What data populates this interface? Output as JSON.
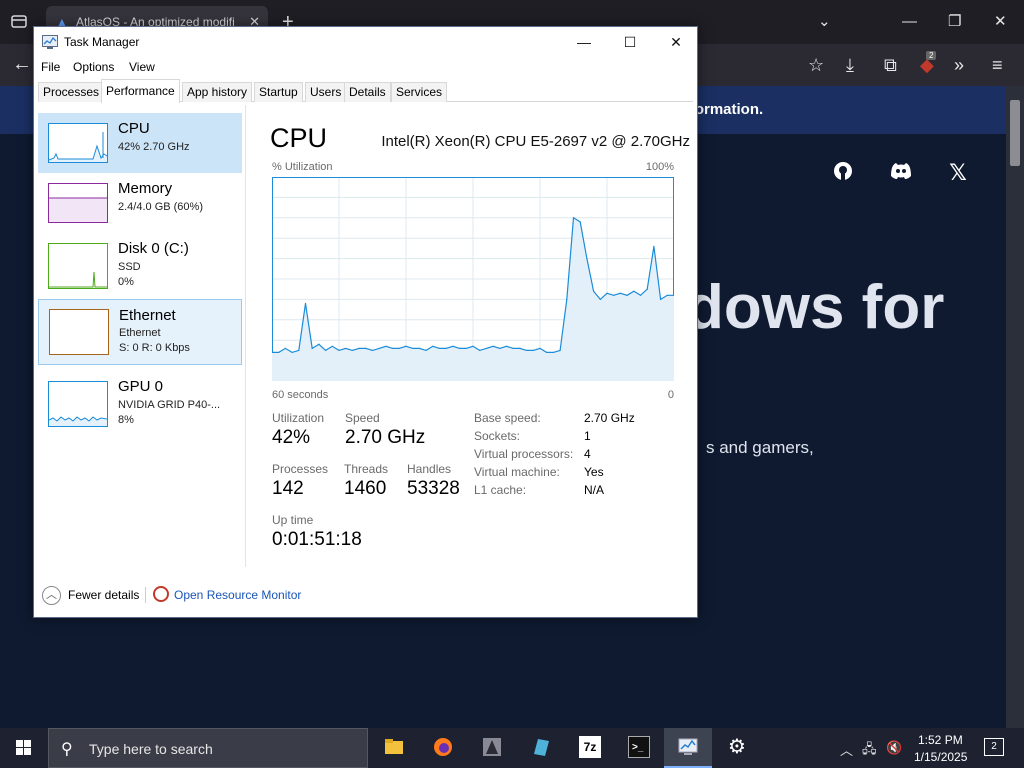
{
  "browser": {
    "tab_title": "AtlasOS - An optimized modifi",
    "new_tab": "+",
    "banner_text": "e information.",
    "hero_text": "dows for",
    "sub_text": "s and gamers,",
    "ublock_count": "2"
  },
  "task_manager": {
    "title": "Task Manager",
    "menu": [
      "File",
      "Options",
      "View"
    ],
    "tabs": [
      "Processes",
      "Performance",
      "App history",
      "Startup",
      "Users",
      "Details",
      "Services"
    ],
    "active_tab": "Performance",
    "resources": [
      {
        "name": "CPU",
        "lines": [
          "42%  2.70 GHz"
        ],
        "color": "#1a8cd8"
      },
      {
        "name": "Memory",
        "lines": [
          "2.4/4.0 GB (60%)"
        ],
        "color": "#8b2a9e"
      },
      {
        "name": "Disk 0 (C:)",
        "lines": [
          "SSD",
          "0%"
        ],
        "color": "#4da81e"
      },
      {
        "name": "Ethernet",
        "lines": [
          "Ethernet",
          "S: 0  R: 0 Kbps"
        ],
        "color": "#a9641c"
      },
      {
        "name": "GPU 0",
        "lines": [
          "NVIDIA GRID P40-...",
          "8%"
        ],
        "color": "#1a8cd8"
      }
    ],
    "cpu": {
      "heading": "CPU",
      "model": "Intel(R) Xeon(R) CPU E5-2697 v2 @ 2.70GHz",
      "chart_top_left": "% Utilization",
      "chart_top_right": "100%",
      "chart_bottom_left": "60 seconds",
      "chart_bottom_right": "0",
      "stats": {
        "utilization_label": "Utilization",
        "utilization": "42%",
        "speed_label": "Speed",
        "speed": "2.70 GHz",
        "processes_label": "Processes",
        "processes": "142",
        "threads_label": "Threads",
        "threads": "1460",
        "handles_label": "Handles",
        "handles": "53328",
        "uptime_label": "Up time",
        "uptime": "0:01:51:18"
      },
      "specs": [
        {
          "label": "Base speed:",
          "value": "2.70 GHz"
        },
        {
          "label": "Sockets:",
          "value": "1"
        },
        {
          "label": "Virtual processors:",
          "value": "4"
        },
        {
          "label": "Virtual machine:",
          "value": "Yes"
        },
        {
          "label": "L1 cache:",
          "value": "N/A"
        }
      ]
    },
    "footer": {
      "fewer_details": "Fewer details",
      "open_resmon": "Open Resource Monitor"
    }
  },
  "chart_data": {
    "type": "area",
    "title": "",
    "xlabel": "60 seconds",
    "ylabel": "% Utilization",
    "xlim": [
      60,
      0
    ],
    "ylim": [
      0,
      100
    ],
    "grid": true,
    "x": [
      60,
      59,
      58,
      57,
      56,
      55,
      54,
      53,
      52,
      51,
      50,
      49,
      48,
      47,
      46,
      45,
      44,
      43,
      42,
      41,
      40,
      39,
      38,
      37,
      36,
      35,
      34,
      33,
      32,
      31,
      30,
      29,
      28,
      27,
      26,
      25,
      24,
      23,
      22,
      21,
      20,
      19,
      18,
      17,
      16,
      15,
      14,
      13,
      12,
      11,
      10,
      9,
      8,
      7,
      6,
      5,
      4,
      3,
      2,
      1,
      0
    ],
    "values": [
      14,
      14,
      16,
      14,
      15,
      38,
      16,
      18,
      15,
      17,
      15,
      16,
      15,
      16,
      16,
      15,
      16,
      17,
      16,
      16,
      17,
      16,
      16,
      15,
      17,
      16,
      16,
      17,
      16,
      16,
      17,
      15,
      16,
      17,
      16,
      17,
      16,
      16,
      15,
      15,
      16,
      14,
      14,
      15,
      40,
      80,
      78,
      60,
      44,
      40,
      43,
      42,
      43,
      42,
      44,
      42,
      45,
      66,
      40,
      42,
      42
    ]
  },
  "taskbar": {
    "search_placeholder": "Type here to search",
    "time": "1:52 PM",
    "date": "1/15/2025",
    "notification_count": "2",
    "apps": [
      "file-explorer",
      "firefox",
      "app-3",
      "app-4",
      "7-zip",
      "terminal",
      "task-manager",
      "settings"
    ]
  }
}
